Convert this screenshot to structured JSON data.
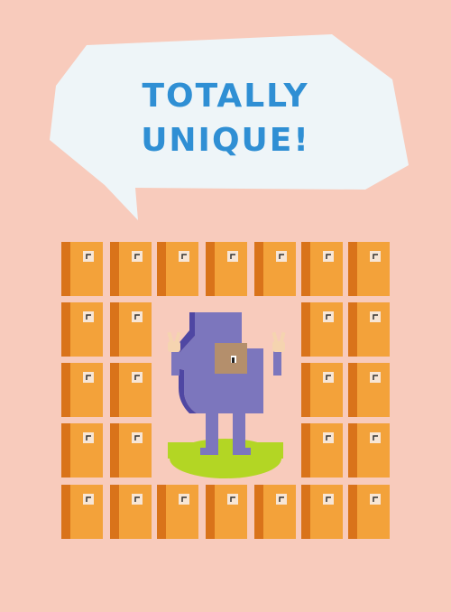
{
  "speech_bubble": {
    "line1": "TOTALLY",
    "line2": "UNIQUE!"
  },
  "colors": {
    "background": "#f8cbbc",
    "bubble": "#eef5f8",
    "text": "#2f8fd4",
    "locker_front": "#f3a23a",
    "locker_side": "#d9731a",
    "character": "#7c76bd",
    "grass": "#b3d624"
  },
  "icons": {
    "left_hand": "peace-sign-hand-icon",
    "right_hand": "peace-sign-hand-icon"
  }
}
